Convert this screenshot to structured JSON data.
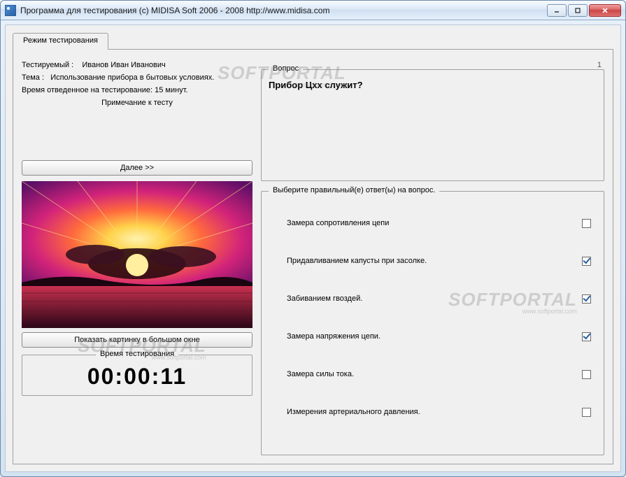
{
  "window": {
    "title": "Программа для тестирования (c) MIDISA Soft 2006 - 2008 http://www.midisa.com"
  },
  "tab": {
    "label": "Режим тестирования"
  },
  "info": {
    "testee_label": "Тестируемый :",
    "testee_value": "Иванов Иван Иванович",
    "topic_label": "Тема :",
    "topic_value": "Использование прибора в бытовых условиях.",
    "time_label": "Время отведенное на тестирование: 15 минут.",
    "note_label": "Примечание к тесту"
  },
  "buttons": {
    "next": "Далее >>",
    "show_image": "Показать картинку в большом окне"
  },
  "timer": {
    "legend": "Время тестирования",
    "value": "00:00:11"
  },
  "question": {
    "number": "1",
    "legend": "Вопрос",
    "text": "Прибор Цхх служит?"
  },
  "answers": {
    "legend": "Выберите правильный(е) ответ(ы) на вопрос.",
    "items": [
      {
        "text": "Замера сопротивления цепи",
        "checked": false
      },
      {
        "text": "Придавливанием капусты при засолке.",
        "checked": true
      },
      {
        "text": "Забиванием гвоздей.",
        "checked": true
      },
      {
        "text": "Замера напряжения цепи.",
        "checked": true
      },
      {
        "text": "Замера силы тока.",
        "checked": false
      },
      {
        "text": "Измерения артериального давления.",
        "checked": false
      }
    ]
  },
  "watermark": {
    "brand": "SOFTPORTAL",
    "url": "www.softportal.com"
  }
}
